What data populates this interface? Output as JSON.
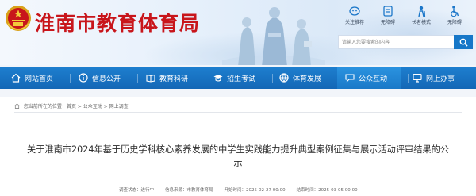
{
  "header": {
    "site_title": "淮南市教育体育局",
    "tools": [
      {
        "label": "关注推荐",
        "icon": "wechat-icon"
      },
      {
        "label": "无障碍",
        "icon": "accessibility-icon"
      },
      {
        "label": "长者模式",
        "icon": "elder-mode-icon"
      },
      {
        "label": "无障碍",
        "icon": "wheelchair-icon"
      }
    ],
    "search": {
      "placeholder": "请输入您要搜索的内容"
    }
  },
  "nav": {
    "items": [
      {
        "label": "网站首页",
        "icon": "home-icon"
      },
      {
        "label": "信息公开",
        "icon": "info-icon"
      },
      {
        "label": "教育科研",
        "icon": "book-icon"
      },
      {
        "label": "招生考试",
        "icon": "graduation-cap-icon"
      },
      {
        "label": "体育发展",
        "icon": "sports-icon"
      },
      {
        "label": "公众互动",
        "icon": "interaction-icon"
      },
      {
        "label": "网上办事",
        "icon": "monitor-icon"
      }
    ],
    "active_index": 5
  },
  "breadcrumb": {
    "prefix": "您当前所在的位置：",
    "items": [
      "首页",
      "公众互动",
      "网上调查"
    ],
    "separator": " > "
  },
  "article": {
    "title": "关于淮南市2024年基于历史学科核心素养发展的中学生实践能力提升典型案例征集与展示活动评审结果的公示",
    "meta": {
      "status": "调查状态：进行中",
      "source": "信息来源：市教育体育局",
      "start": "开始时间：2025-02-27 00:00",
      "end": "结束时间：2025-03-05 00:00"
    }
  },
  "colors": {
    "brand_red": "#c8151b",
    "nav_blue": "#1671c0",
    "search_blue": "#1677c8"
  }
}
